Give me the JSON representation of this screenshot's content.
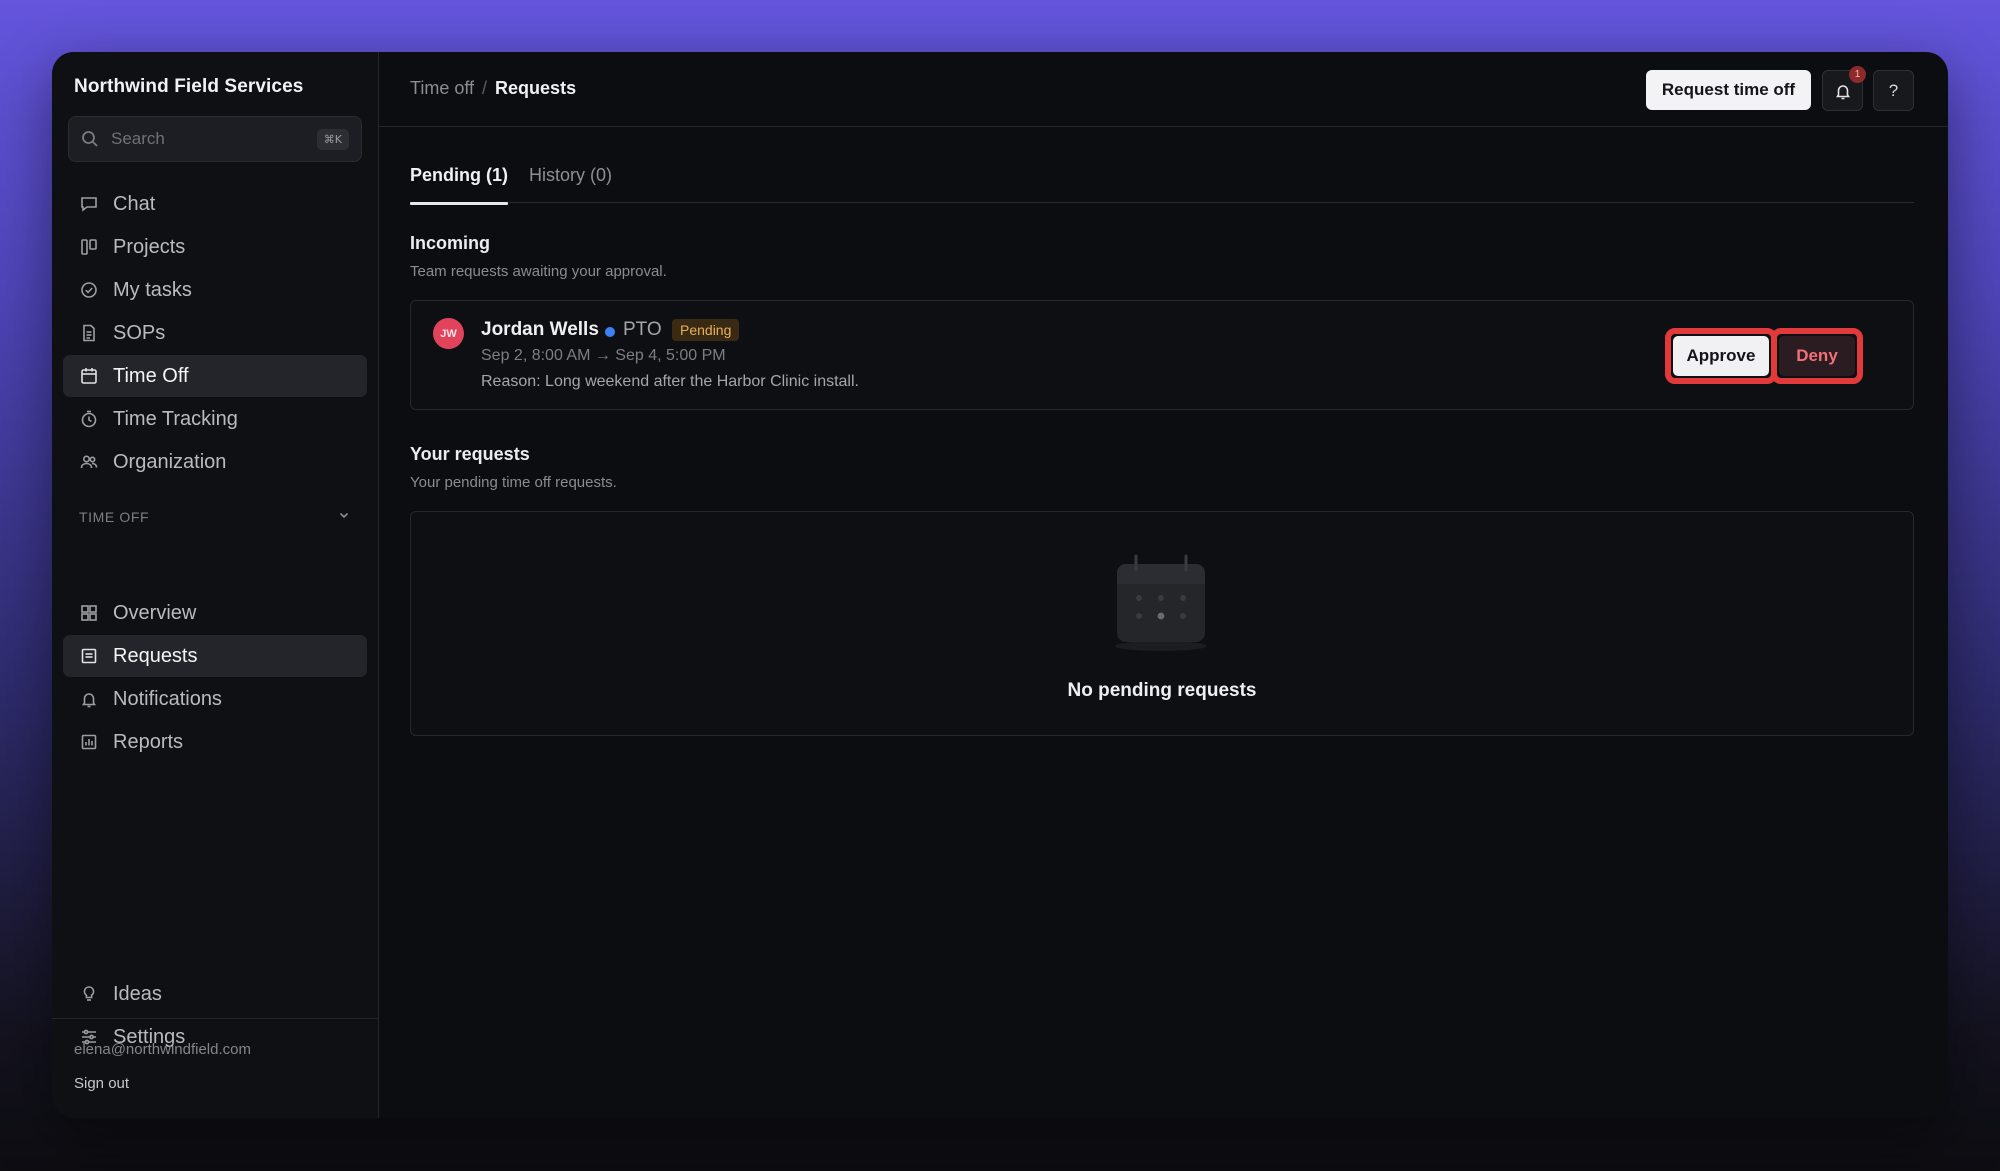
{
  "sidebar": {
    "brand": "Northwind Field Services",
    "search": {
      "placeholder": "Search",
      "shortcut": "⌘K"
    },
    "nav": [
      {
        "label": "Chat",
        "icon": "chat-icon"
      },
      {
        "label": "Projects",
        "icon": "board-icon"
      },
      {
        "label": "My tasks",
        "icon": "check-circle-icon"
      },
      {
        "label": "SOPs",
        "icon": "document-icon"
      },
      {
        "label": "Time Off",
        "icon": "calendar-icon",
        "active": true
      },
      {
        "label": "Time Tracking",
        "icon": "clock-icon"
      },
      {
        "label": "Organization",
        "icon": "users-icon"
      }
    ],
    "section": {
      "label": "TIME OFF"
    },
    "sub_nav": [
      {
        "label": "Overview",
        "icon": "grid-icon"
      },
      {
        "label": "Requests",
        "icon": "list-icon",
        "active": true
      },
      {
        "label": "Notifications",
        "icon": "bell-icon"
      },
      {
        "label": "Reports",
        "icon": "chart-icon"
      }
    ],
    "bottom_nav": [
      {
        "label": "Ideas",
        "icon": "lightbulb-icon"
      },
      {
        "label": "Settings",
        "icon": "sliders-icon"
      }
    ],
    "footer": {
      "email": "elena@northwindfield.com",
      "signout": "Sign out"
    }
  },
  "header": {
    "breadcrumb": {
      "parent": "Time off",
      "separator": "/",
      "current": "Requests"
    },
    "request_button": "Request time off",
    "notification_count": "1",
    "help_label": "?"
  },
  "tabs": [
    {
      "label": "Pending (1)",
      "active": true
    },
    {
      "label": "History (0)",
      "active": false
    }
  ],
  "incoming": {
    "title": "Incoming",
    "subtitle": "Team requests awaiting your approval.",
    "request": {
      "initials": "JW",
      "name": "Jordan Wells",
      "type": "PTO",
      "status": "Pending",
      "dates": "Sep 2, 8:00 AM → Sep 4, 5:00 PM",
      "reason": "Reason: Long weekend after the Harbor Clinic install.",
      "approve": "Approve",
      "deny": "Deny"
    }
  },
  "your_requests": {
    "title": "Your requests",
    "subtitle": "Your pending time off requests.",
    "empty": "No pending requests"
  },
  "colors": {
    "accent_highlight": "#e23a3a",
    "status_pending": "#e8b05a",
    "avatar": "#e0435a",
    "pto_dot": "#3b82f6",
    "deny": "#f0707a"
  }
}
